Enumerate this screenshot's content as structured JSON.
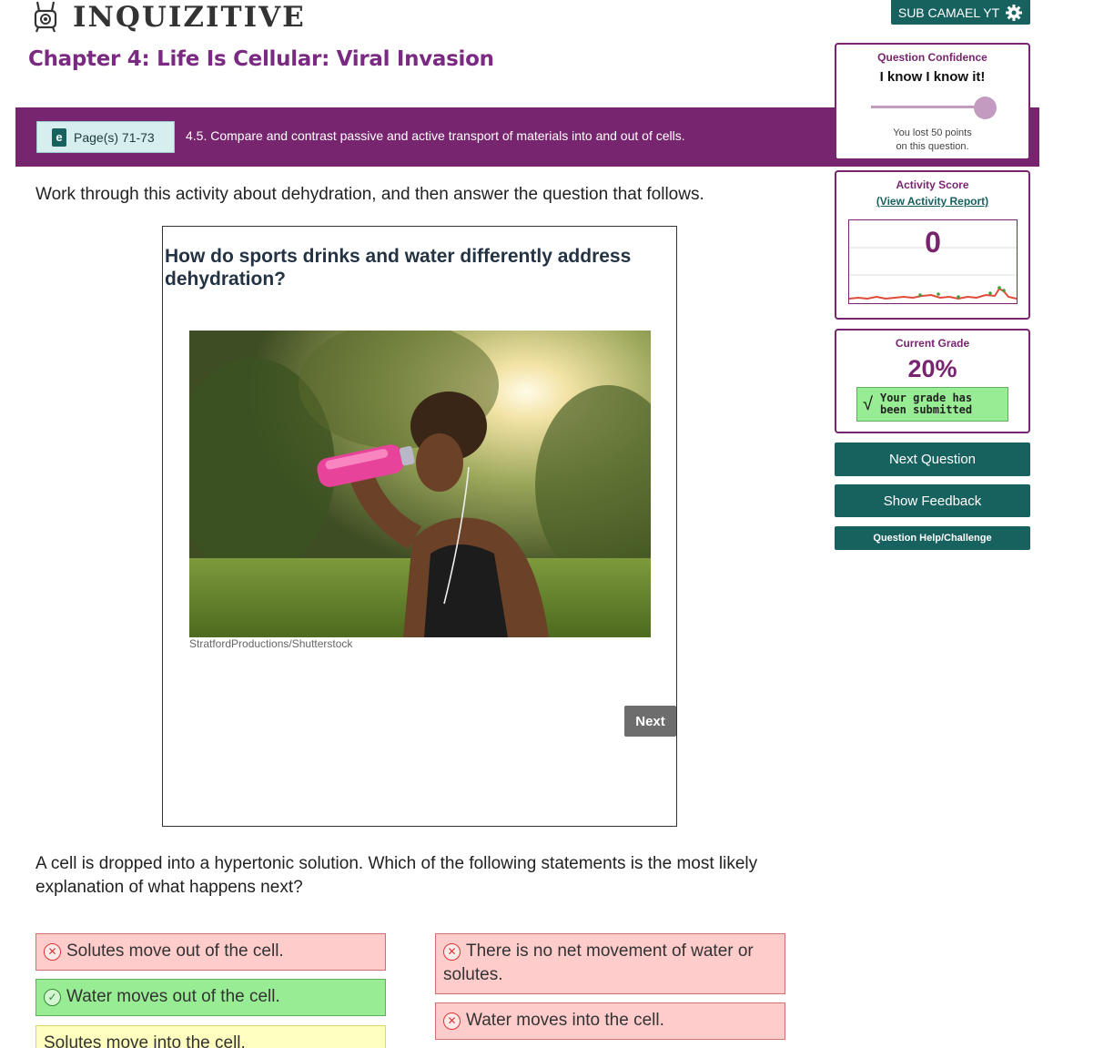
{
  "app": {
    "logo_text": "INQUIZITIVE",
    "chapter_title": "Chapter 4: Life Is Cellular: Viral Invasion",
    "user_button_label": "SUB CAMAEL YT"
  },
  "objective": {
    "page_ref": "Page(s) 71-73",
    "text": "4.5. Compare and contrast passive and active transport of materials into and out of cells."
  },
  "instruction": "Work through this activity about dehydration, and then answer the question that follows.",
  "activity": {
    "heading": "How do sports drinks and water differently address dehydration?",
    "photo_credit": "StratfordProductions/Shutterstock",
    "next_label": "Next"
  },
  "question": "A cell is dropped into a hypertonic solution. Which of the following statements is the most likely explanation of what happens next?",
  "answers": [
    {
      "text": "Solutes move out of the cell.",
      "status": "wrong"
    },
    {
      "text": "Water moves out of the cell.",
      "status": "correct"
    },
    {
      "text": "Solutes move into the cell.",
      "status": "unselected"
    },
    {
      "text": "There is no net movement of water or solutes.",
      "status": "wrong"
    },
    {
      "text": "Water moves into the cell.",
      "status": "wrong"
    }
  ],
  "sidebar": {
    "confidence": {
      "label": "Question Confidence",
      "value": "I know I know it!",
      "slider_level": 1.0,
      "lost_text_line1": "You lost 50 points",
      "lost_text_line2": "on this question."
    },
    "score": {
      "label": "Activity Score",
      "report_link": "(View Activity Report)",
      "value": "0"
    },
    "grade": {
      "label": "Current Grade",
      "value": "20%",
      "submitted_line1": "Your grade has",
      "submitted_line2": "been submitted"
    },
    "buttons": {
      "next_question": "Next Question",
      "show_feedback": "Show Feedback",
      "help": "Question Help/Challenge"
    }
  },
  "colors": {
    "brand_purple": "#78256f",
    "brand_teal": "#17615f",
    "wrong_bg": "#ffcccc",
    "correct_bg": "#98ec94",
    "neutral_bg": "#ffffc0"
  }
}
